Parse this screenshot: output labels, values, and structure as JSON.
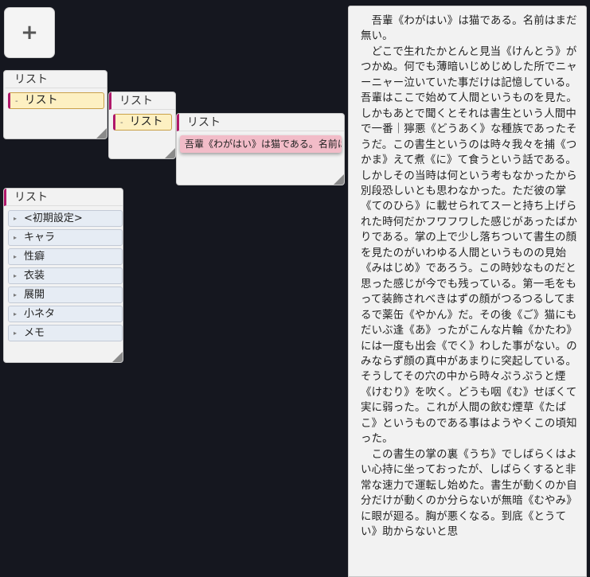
{
  "toolbar": {
    "add_label": "+"
  },
  "panel1": {
    "title": "リスト",
    "item_label": "リスト",
    "item_marker": "-"
  },
  "panel2": {
    "title": "リスト",
    "item_label": "リスト",
    "item_marker": "-"
  },
  "panel3": {
    "title": "リスト",
    "item_label": "吾輩《わがはい》は猫である。名前は"
  },
  "panel4": {
    "title": "リスト",
    "item_marker": "▸",
    "items": [
      "<初期設定>",
      "キャラ",
      "性癖",
      "衣装",
      "展開",
      "小ネタ",
      "メモ"
    ]
  },
  "text_panel": {
    "body": "　吾輩《わがはい》は猫である。名前はまだ無い。\n　どこで生れたかとんと見当《けんとう》がつかぬ。何でも薄暗いじめじめした所でニャーニャー泣いていた事だけは記憶している。吾輩はここで始めて人間というものを見た。しかもあとで聞くとそれは書生という人間中で一番｜獰悪《どうあく》な種族であったそうだ。この書生というのは時々我々を捕《つかま》えて煮《に》て食うという話である。しかしその当時は何という考もなかったから別段恐しいとも思わなかった。ただ彼の掌《てのひら》に載せられてスーと持ち上げられた時何だかフワフワした感じがあったばかりである。掌の上で少し落ちついて書生の顔を見たのがいわゆる人間というものの見始《みはじめ》であろう。この時妙なものだと思った感じが今でも残っている。第一毛をもって装飾されべきはずの顔がつるつるしてまるで薬缶《やかん》だ。その後《ご》猫にもだいぶ逢《あ》ったがこんな片輪《かたわ》には一度も出会《でく》わした事がない。のみならず顔の真中があまりに突起している。そうしてその穴の中から時々ぷうぷうと煙《けむり》を吹く。どうも咽《む》せぼくて実に弱った。これが人間の飲む煙草《たばこ》というものである事はようやくこの頃知った。\n　この書生の掌の裏《うち》でしばらくはよい心持に坐っておったが、しばらくすると非常な速力で運転し始めた。書生が動くのか自分だけが動くのか分らないが無暗《むやみ》に眼が廻る。胸が悪くなる。到底《とうてい》助からないと思"
  }
}
